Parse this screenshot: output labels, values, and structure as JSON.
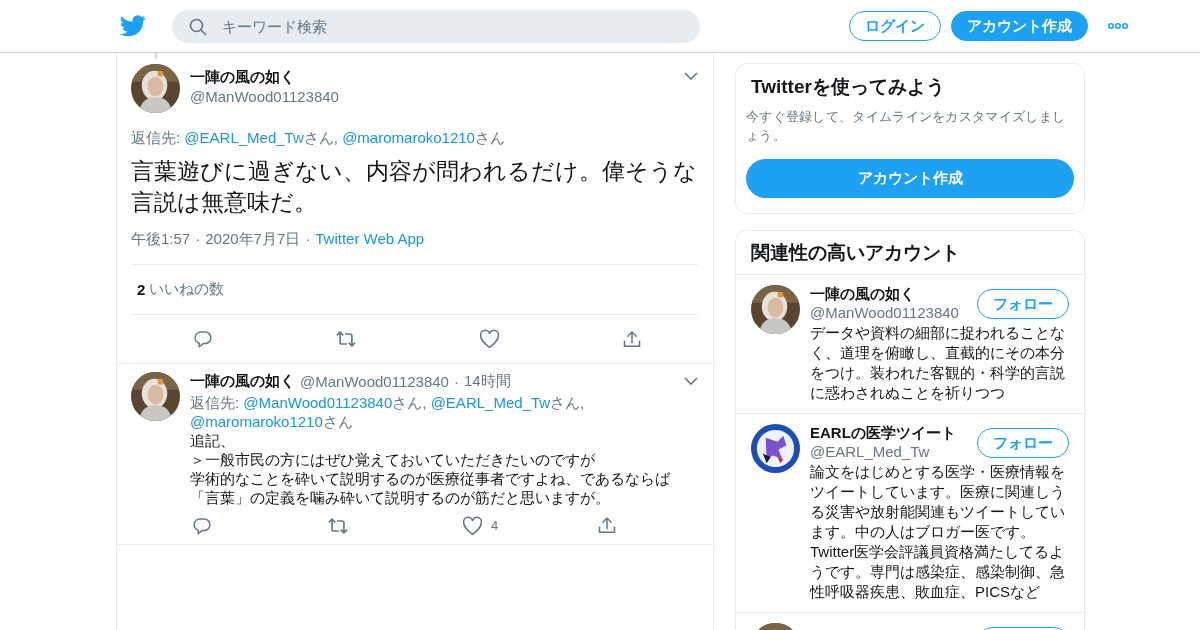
{
  "header": {
    "search": {
      "placeholder": "キーワード検索"
    },
    "login": "ログイン",
    "signup": "アカウント作成"
  },
  "tweet": {
    "name": "一陣の風の如く",
    "handle": "@ManWood01123840",
    "reply_to": [
      {
        "kind": "label",
        "text": "返信先: "
      },
      {
        "kind": "link",
        "text": "@EARL_Med_Tw"
      },
      {
        "kind": "plain",
        "text": "さん, "
      },
      {
        "kind": "link",
        "text": "@maromaroko1210"
      },
      {
        "kind": "plain",
        "text": "さん"
      }
    ],
    "text": "言葉遊びに過ぎない、内容が問われるだけ。偉そうな言説は無意味だ。",
    "time": "午後1:57",
    "date": "2020年7月7日",
    "source": "Twitter Web App",
    "separator": "·",
    "likes": {
      "count": "2",
      "label": "いいねの数"
    }
  },
  "reply": {
    "name": "一陣の風の如く",
    "handle": "@ManWood01123840",
    "separator": "·",
    "time": "14時間",
    "reply_to": [
      {
        "kind": "label",
        "text": "返信先: "
      },
      {
        "kind": "link",
        "text": "@ManWood01123840"
      },
      {
        "kind": "plain",
        "text": "さん, "
      },
      {
        "kind": "link",
        "text": "@EARL_Med_Tw"
      },
      {
        "kind": "plain",
        "text": "さん, "
      },
      {
        "kind": "link",
        "text": "@maromaroko1210"
      },
      {
        "kind": "plain",
        "text": "さん"
      }
    ],
    "lines": [
      "追記、",
      "＞一般市民の方にはぜひ覚えておいていただきたいのですが",
      "学術的なことを砕いて説明するのが医療従事者ですよね、であるならば",
      "「言葉」の定義を噛み砕いて説明するのが筋だと思いますが。"
    ],
    "like_count": "4"
  },
  "signup_card": {
    "title": "Twitterを使ってみよう",
    "text": "今すぐ登録して、タイムラインをカスタマイズしましょう。",
    "button": "アカウント作成"
  },
  "related": {
    "title": "関連性の高いアカウント",
    "more_below": true,
    "accounts": [
      {
        "name": "一陣の風の如く",
        "handle": "@ManWood01123840",
        "button": "フォロー",
        "kind": "figure",
        "bio": "データや資料の細部に捉われることなく、道理を俯瞰し、直截的にその本分をつけ。装われた客観的・科学的言説に惑わされぬことを祈りつつ"
      },
      {
        "name": "EARLの医学ツイート",
        "handle": "@EARL_Med_Tw",
        "button": "フォロー",
        "kind": "emblem",
        "bio": "論文をはじめとする医学・医療情報をツイートしています。医療に関連しうる災害や放射能関連もツイートしています。中の人はブロガー医です。Twitter医学会評議員資格満たしてるようです。専門は感染症、感染制御、急性呼吸器疾患、敗血症、PICSなど"
      }
    ]
  }
}
